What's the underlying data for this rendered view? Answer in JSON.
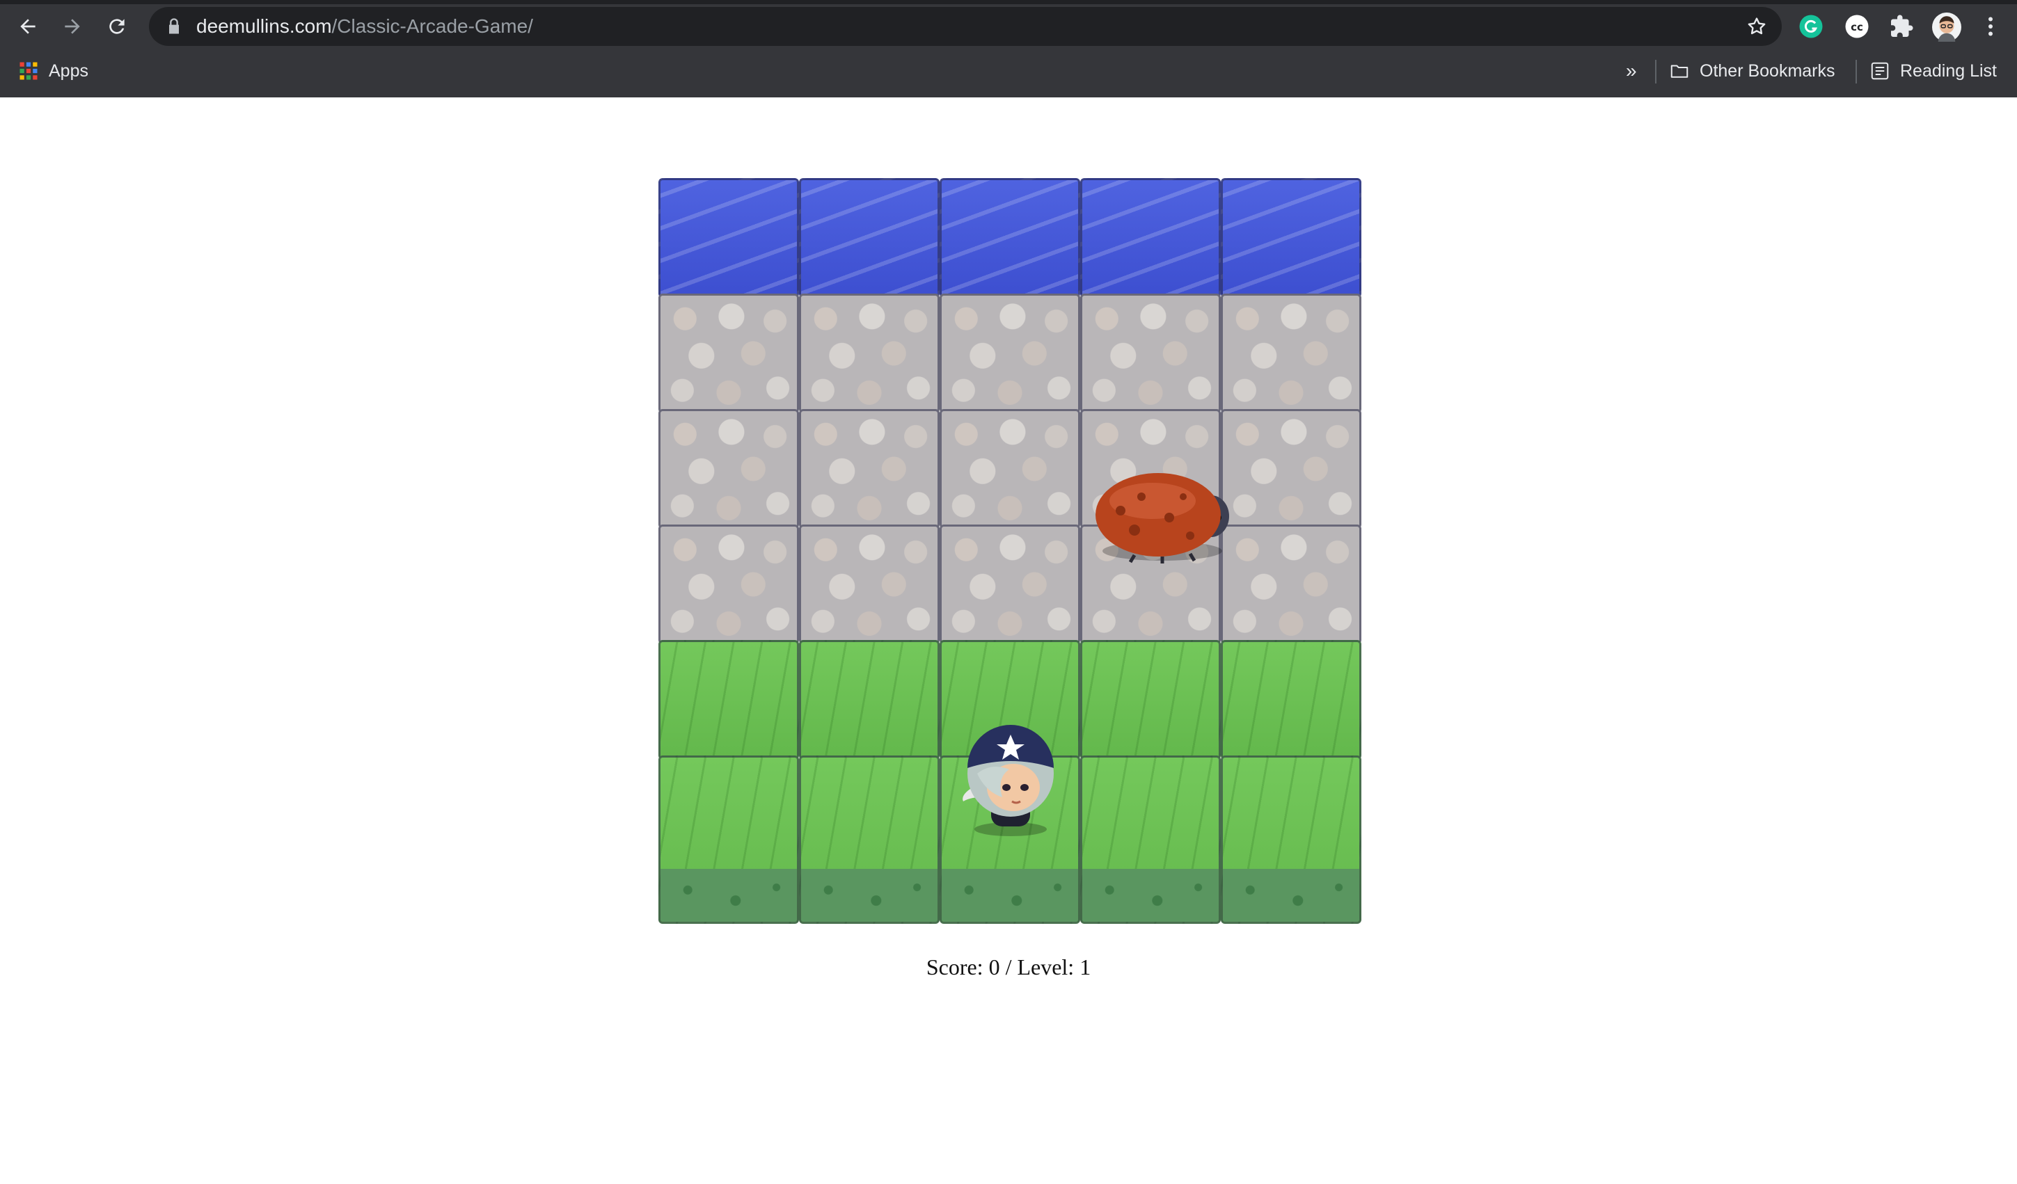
{
  "browser": {
    "url_domain": "deemullins.com",
    "url_path": "/Classic-Arcade-Game/",
    "bookmarks": {
      "apps_label": "Apps",
      "overflow_label": "»",
      "other_bookmarks_label": "Other Bookmarks",
      "reading_list_label": "Reading List"
    },
    "icons": [
      "back-icon",
      "forward-icon",
      "reload-icon",
      "lock-icon",
      "star-icon",
      "grammarly-icon",
      "cc-icon",
      "extensions-icon",
      "profile-avatar-icon",
      "menu-icon",
      "apps-grid-icon",
      "folder-icon",
      "reading-list-icon"
    ]
  },
  "game": {
    "columns": 5,
    "rows": [
      "water",
      "stone",
      "stone",
      "stone",
      "grass",
      "grass"
    ],
    "enemy": {
      "type": "bug",
      "row": 3,
      "column": 4
    },
    "player": {
      "type": "character",
      "row": 6,
      "column": 3
    },
    "score_text": "Score: 0 / Level: 1"
  }
}
